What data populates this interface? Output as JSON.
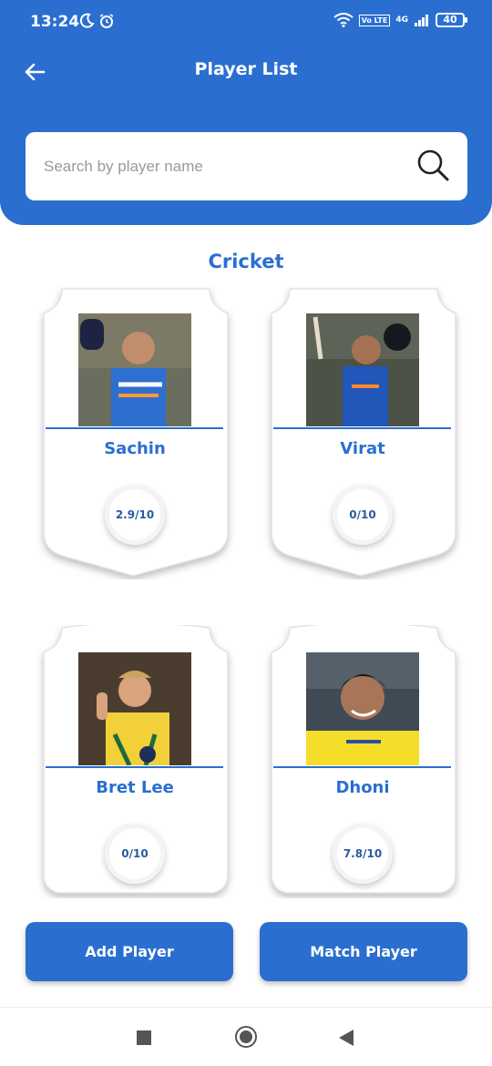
{
  "status_bar": {
    "time": "13:24",
    "network": "4G",
    "volte": "Vo LTE",
    "battery": "40"
  },
  "header": {
    "title": "Player List",
    "back_icon": "arrow-left-icon"
  },
  "search": {
    "placeholder": "Search by player name",
    "value": "",
    "icon": "search-icon"
  },
  "section": {
    "title": "Cricket"
  },
  "players": [
    {
      "name": "Sachin",
      "rating": "2.9/10",
      "jersey_color": "#2f6fd0"
    },
    {
      "name": "Virat",
      "rating": "0/10",
      "jersey_color": "#2256b8"
    },
    {
      "name": "Bret Lee",
      "rating": "0/10",
      "jersey_color": "#f2d03a"
    },
    {
      "name": "Dhoni",
      "rating": "7.8/10",
      "jersey_color": "#f4de2a"
    }
  ],
  "buttons": {
    "add_player": "Add Player",
    "match_player": "Match Player"
  },
  "colors": {
    "primary": "#2a6fd0",
    "rating_text": "#2b5aa0"
  }
}
